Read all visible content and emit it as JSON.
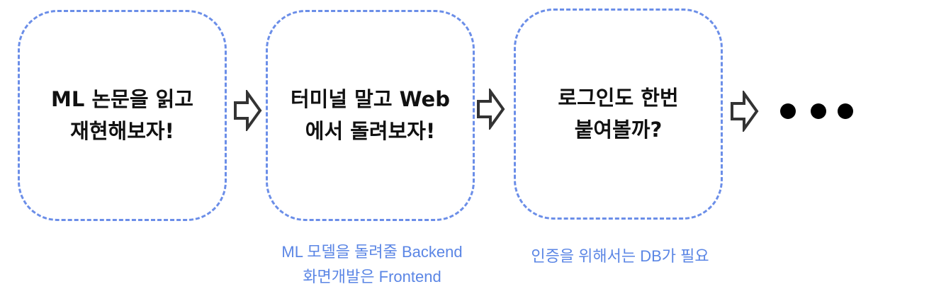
{
  "boxes": [
    {
      "text": "ML 논문을 읽고\n재현해보자!"
    },
    {
      "text": "터미널 말고 Web\n에서 돌려보자!"
    },
    {
      "text": "로그인도 한번\n붙여볼까?"
    }
  ],
  "captions": {
    "step2": [
      "ML 모델을 돌려줄 Backend",
      "화면개발은 Frontend"
    ],
    "step3": [
      "인증을 위해서는 DB가 필요"
    ]
  },
  "arrows": [
    {
      "icon": "hollow-right-arrow-icon",
      "from": "box1",
      "to": "box2"
    },
    {
      "icon": "hollow-right-arrow-icon",
      "from": "box2",
      "to": "box3"
    },
    {
      "icon": "hollow-right-arrow-icon",
      "from": "box3",
      "to": "ellipsis"
    }
  ],
  "ellipsis_icon": "ellipsis-dots-icon",
  "colors": {
    "box_border": "#6b8ee8",
    "caption_text": "#5b86e5",
    "box_text": "#111111",
    "arrow_stroke": "#333333"
  }
}
